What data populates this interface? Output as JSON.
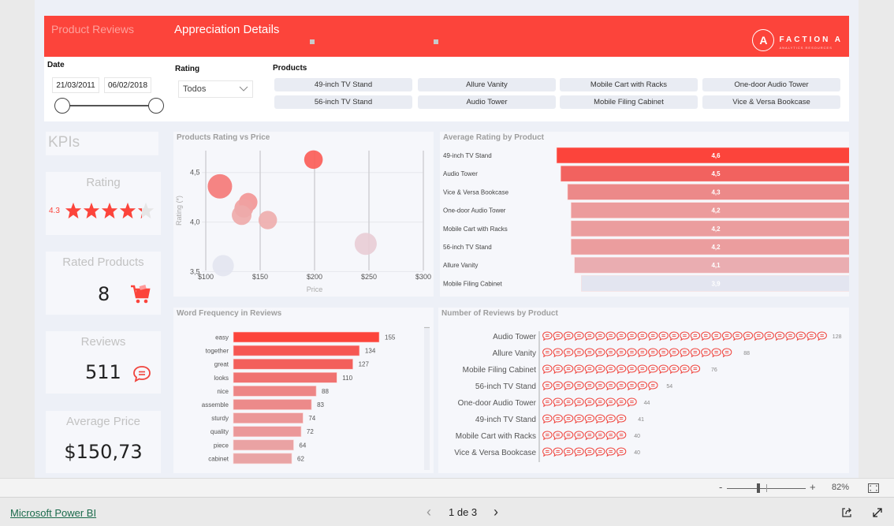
{
  "header": {
    "tabs": [
      {
        "label": "Product Reviews",
        "active": false
      },
      {
        "label": "Appreciation Details",
        "active": true
      }
    ],
    "logo": {
      "brand": "FACTION A",
      "tagline": "ANALYTICS RESOURCES",
      "mark": "A"
    },
    "colors": {
      "accent": "#fc443b"
    }
  },
  "filters": {
    "date": {
      "label": "Date",
      "start": "21/03/2011",
      "end": "06/02/2018"
    },
    "rating": {
      "label": "Rating",
      "selected": "Todos"
    },
    "products": {
      "label": "Products",
      "items": [
        "49-inch TV Stand",
        "Allure Vanity",
        "Mobile Cart with Racks",
        "One-door Audio Tower",
        "56-inch TV Stand",
        "Audio Tower",
        "Mobile Filing Cabinet",
        "Vice & Versa Bookcase"
      ]
    }
  },
  "kpis": {
    "title": "KPIs",
    "rating": {
      "label": "Rating",
      "value": "4.3",
      "stars_filled": 4.3,
      "stars_total": 5
    },
    "rated_products": {
      "label": "Rated Products",
      "value": "8",
      "icon": "shopping-cart-icon"
    },
    "reviews": {
      "label": "Reviews",
      "value": "511",
      "icon": "speech-bubble-icon"
    },
    "average_price": {
      "label": "Average Price",
      "value": "$150,73"
    }
  },
  "chart_data": [
    {
      "id": "rating-vs-price",
      "type": "scatter",
      "title": "Products Rating vs Price",
      "xlabel": "Price",
      "ylabel": "Rating (*)",
      "xlim": [
        100,
        300
      ],
      "ylim": [
        3.4,
        4.8
      ],
      "x_ticks": [
        100,
        150,
        200,
        250,
        300
      ],
      "x_tick_labels": [
        "$100",
        "$150",
        "$200",
        "$250",
        "$300"
      ],
      "y_ticks": [
        3.5,
        4.0,
        4.5
      ],
      "y_tick_labels": [
        "3,5",
        "4,0",
        "4,5"
      ],
      "points": [
        {
          "x": 199,
          "y": 4.63,
          "size": 41,
          "color": "#fb5d58"
        },
        {
          "x": 113,
          "y": 4.36,
          "size": 128,
          "color": "#f47a78"
        },
        {
          "x": 139,
          "y": 4.2,
          "size": 40,
          "color": "#f29696"
        },
        {
          "x": 135,
          "y": 4.14,
          "size": 44,
          "color": "#f0a2a2"
        },
        {
          "x": 133,
          "y": 4.07,
          "size": 54,
          "color": "#eeaaaa"
        },
        {
          "x": 157,
          "y": 4.02,
          "size": 40,
          "color": "#eeaeae"
        },
        {
          "x": 247,
          "y": 3.78,
          "size": 88,
          "color": "#e8cdd6"
        },
        {
          "x": 116,
          "y": 3.56,
          "size": 76,
          "color": "#e3e5f0"
        }
      ]
    },
    {
      "id": "average-rating-by-product",
      "type": "bar",
      "title": "Average Rating by Product",
      "categories": [
        "49-inch TV Stand",
        "Audio Tower",
        "Vice & Versa Bookcase",
        "One-door Audio Tower",
        "Mobile Cart with Racks",
        "56-inch TV Stand",
        "Allure Vanity",
        "Mobile Filing Cabinet"
      ],
      "values": [
        4.6,
        4.5,
        4.3,
        4.2,
        4.2,
        4.2,
        4.1,
        3.9
      ],
      "value_labels": [
        "4,6",
        "4,5",
        "4,3",
        "4,2",
        "4,2",
        "4,2",
        "4,1",
        "3,9"
      ],
      "colors": [
        "#fc443b",
        "#f2625f",
        "#ec8989",
        "#ec9b9c",
        "#eb9d9e",
        "#eb9d9e",
        "#eaadb1",
        "#e3e5f0"
      ],
      "orientation": "horizontal-funnel"
    },
    {
      "id": "word-frequency",
      "type": "bar",
      "title": "Word Frequency in Reviews",
      "categories": [
        "easy",
        "together",
        "great",
        "looks",
        "nice",
        "assemble",
        "sturdy",
        "quality",
        "piece",
        "cabinet"
      ],
      "values": [
        155,
        134,
        127,
        110,
        88,
        83,
        74,
        72,
        64,
        62
      ],
      "colors": [
        "#fc443b",
        "#f65753",
        "#f35f5b",
        "#f07271",
        "#ed8686",
        "#ec8a8a",
        "#eb9797",
        "#eb9899",
        "#eaa2a3",
        "#e9a4a5"
      ],
      "orientation": "horizontal"
    },
    {
      "id": "reviews-by-product",
      "type": "bar",
      "title": "Number of Reviews by Product",
      "categories": [
        "Audio Tower",
        "Allure Vanity",
        "Mobile Filing Cabinet",
        "56-inch TV Stand",
        "One-door Audio Tower",
        "49-inch TV Stand",
        "Mobile Cart with Racks",
        "Vice & Versa Bookcase"
      ],
      "values": [
        128,
        88,
        76,
        54,
        44,
        41,
        40,
        40
      ],
      "icon_counts": [
        27,
        18,
        15,
        11,
        9,
        8,
        8,
        8
      ],
      "icon": "speech-bubble-icon",
      "orientation": "horizontal-pictogram"
    }
  ],
  "statusbar": {
    "zoom_level": "82%",
    "zoom_minus": "-",
    "zoom_plus": "+",
    "zoom_fraction": 0.4
  },
  "footer": {
    "brand_link": "Microsoft Power BI",
    "page_indicator": "1 de 3",
    "prev": "‹",
    "next": "›"
  }
}
